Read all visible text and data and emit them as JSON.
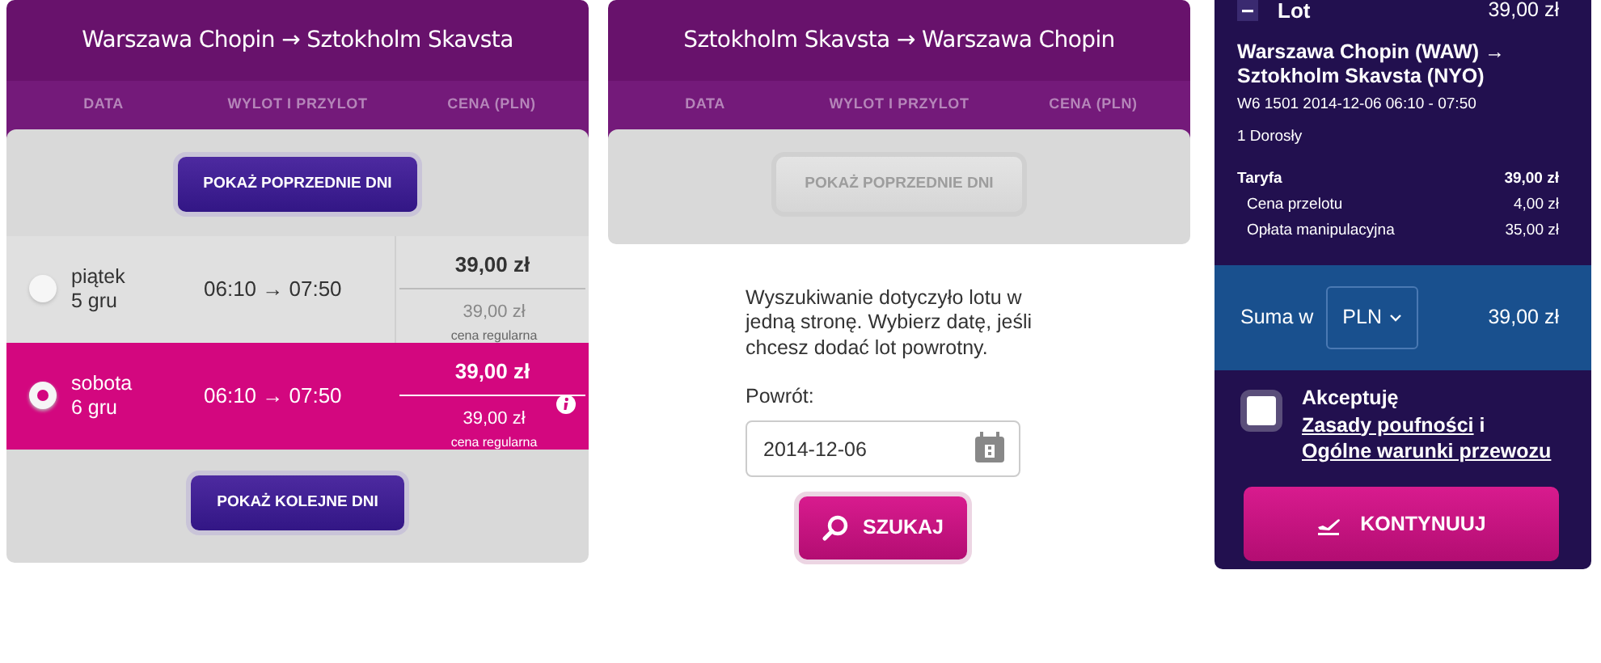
{
  "outbound": {
    "title": "Warszawa Chopin → Sztokholm Skavsta",
    "columns": [
      "DATA",
      "WYLOT I PRZYLOT",
      "CENA (PLN)"
    ],
    "prev_button": {
      "label": "POKAŻ POPRZEDNIE DNI",
      "disabled": false
    },
    "days": [
      {
        "weekday": "piątek",
        "date": "5 gru",
        "times": "06:10 → 07:50",
        "price": "39,00 zł",
        "regular_price": "39,00 zł",
        "regular_label": "cena regularna",
        "selected": false,
        "info": false
      },
      {
        "weekday": "sobota",
        "date": "6 gru",
        "times": "06:10 → 07:50",
        "price": "39,00 zł",
        "regular_price": "39,00 zł",
        "regular_label": "cena regularna",
        "selected": true,
        "info": true
      }
    ],
    "next_button": {
      "label": "POKAŻ KOLEJNE DNI",
      "disabled": false
    }
  },
  "return": {
    "title": "Sztokholm Skavsta → Warszawa Chopin",
    "columns": [
      "DATA",
      "WYLOT I PRZYLOT",
      "CENA (PLN)"
    ],
    "prev_button": {
      "label": "POKAŻ POPRZEDNIE DNI",
      "disabled": true
    },
    "message": "Wyszukiwanie dotyczyło lotu w jedną stronę. Wybierz datę, jeśli chcesz dodać lot powrotny.",
    "field_label": "Powrót:",
    "date_value": "2014-12-06",
    "search_button": "SZUKAJ"
  },
  "summary": {
    "section": "Lot",
    "section_price": "39,00 zł",
    "route": "Warszawa Chopin (WAW) → Sztokholm Skavsta (NYO)",
    "flight": "W6 1501  2014-12-06 06:10 - 07:50",
    "passengers": "1 Dorosły",
    "fare_rows": [
      {
        "label": "Taryfa",
        "amount": "39,00 zł",
        "kind": "total"
      },
      {
        "label": "Cena przelotu",
        "amount": "4,00 zł",
        "kind": "item"
      },
      {
        "label": "Opłata manipulacyjna",
        "amount": "35,00 zł",
        "kind": "item"
      }
    ],
    "total_label": "Suma w",
    "currency": "PLN",
    "total": "39,00 zł",
    "terms": [
      {
        "text": "Akceptuję",
        "kind": "text"
      },
      {
        "text": "Zasady poufności",
        "kind": "link"
      },
      {
        "text": "i",
        "kind": "text"
      },
      {
        "text": "Ogólne warunki przewozu",
        "kind": "link"
      }
    ],
    "terms_checked": false,
    "continue_button": "KONTYNUUJ"
  }
}
